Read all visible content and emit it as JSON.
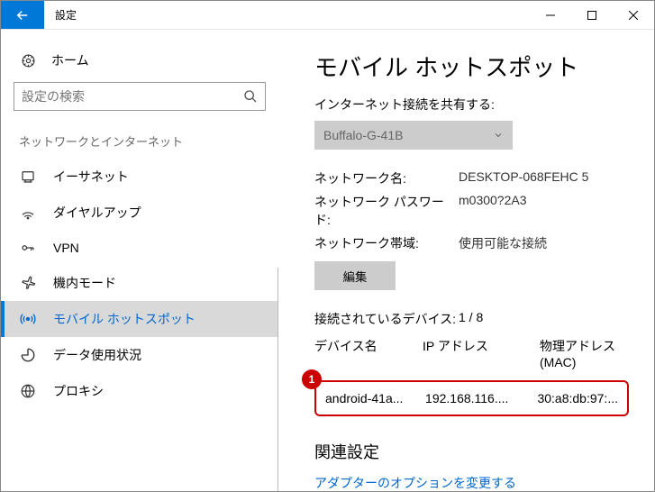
{
  "window": {
    "title": "設定"
  },
  "sidebar": {
    "home": "ホーム",
    "search_placeholder": "設定の検索",
    "section": "ネットワークとインターネット",
    "items": [
      {
        "label": "イーサネット"
      },
      {
        "label": "ダイヤルアップ"
      },
      {
        "label": "VPN"
      },
      {
        "label": "機内モード"
      },
      {
        "label": "モバイル ホットスポット"
      },
      {
        "label": "データ使用状況"
      },
      {
        "label": "プロキシ"
      }
    ]
  },
  "content": {
    "heading": "モバイル ホットスポット",
    "share_label": "インターネット接続を共有する:",
    "combo_value": "Buffalo-G-41B",
    "info": {
      "name_label": "ネットワーク名:",
      "name_value": "DESKTOP-068FEHC 5",
      "pass_label": "ネットワーク パスワード:",
      "pass_value": "m0300?2A3",
      "band_label": "ネットワーク帯域:",
      "band_value": "使用可能な接続"
    },
    "edit_label": "編集",
    "devices_label": "接続されているデバイス:",
    "devices_count": "1 / 8",
    "table": {
      "col1": "デバイス名",
      "col2": "IP アドレス",
      "col3": "物理アドレス (MAC)"
    },
    "row": {
      "device": "android-41a...",
      "ip": "192.168.116....",
      "mac": "30:a8:db:97:..."
    },
    "badge": "1",
    "related": "関連設定",
    "link": "アダプターのオプションを変更する"
  }
}
